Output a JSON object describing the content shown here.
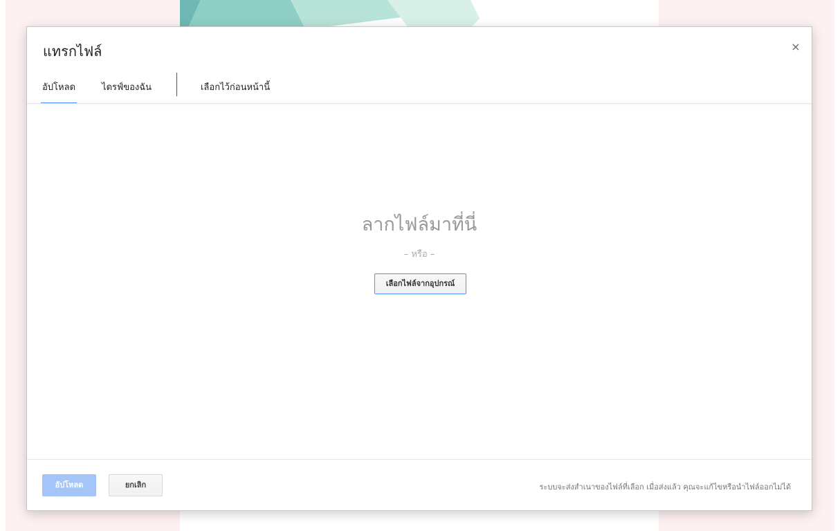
{
  "dialog": {
    "title": "แทรกไฟล์",
    "close_label": "×"
  },
  "tabs": [
    {
      "label": "อัปโหลด",
      "active": true
    },
    {
      "label": "ไดรฟ์ของฉัน",
      "active": false
    },
    {
      "label": "เลือกไว้ก่อนหน้านี้",
      "active": false
    }
  ],
  "dropzone": {
    "title": "ลากไฟล์มาที่นี่",
    "or_text": "– หรือ –",
    "select_button": "เลือกไฟล์จากอุปกรณ์"
  },
  "footer": {
    "upload_button": "อัปโหลด",
    "cancel_button": "ยกเลิก",
    "note": "ระบบจะส่งสำเนาของไฟล์ที่เลือก เมื่อส่งแล้ว คุณจะแก้ไขหรือนำไฟล์ออกไม่ได้"
  },
  "colors": {
    "accent": "#4d90fe",
    "upload_disabled": "#a5c4f7",
    "background_tint": "#fdf1f1",
    "banner_teal": "#7fc3bd"
  }
}
